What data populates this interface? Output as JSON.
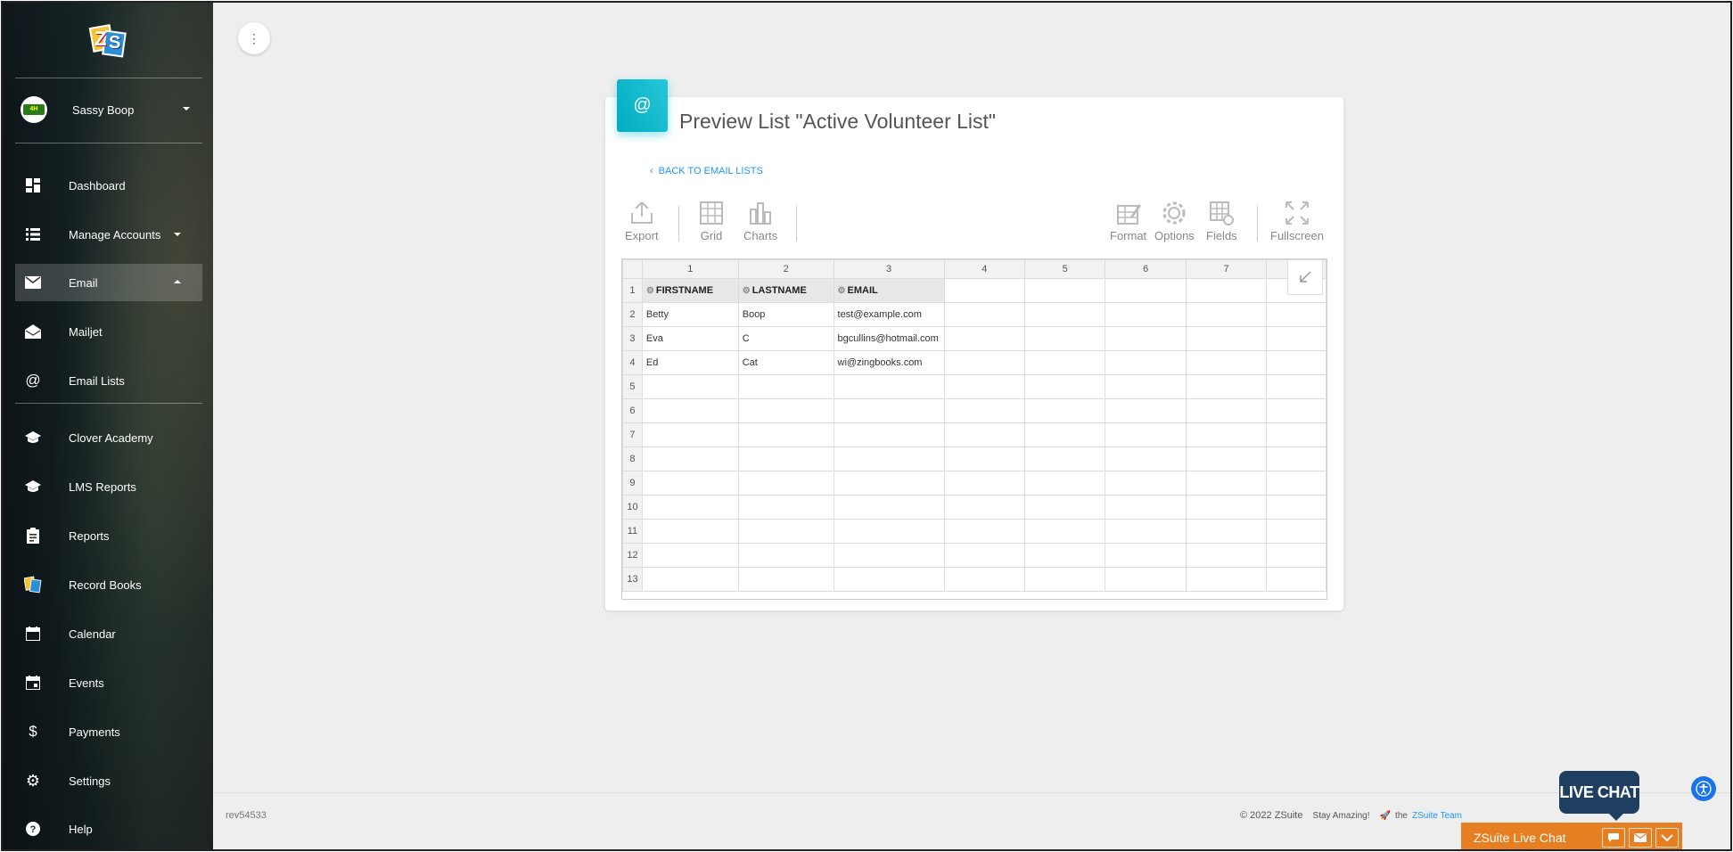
{
  "sidebar": {
    "user_name": "Sassy Boop",
    "avatar_text": "4H",
    "nav": [
      {
        "label": "Dashboard",
        "icon": "dashboard-icon"
      },
      {
        "label": "Manage Accounts",
        "icon": "list-icon"
      },
      {
        "label": "Email",
        "icon": "mail-icon"
      },
      {
        "label": "Mailjet",
        "icon": "drafts-icon"
      },
      {
        "label": "Email Lists",
        "icon": "at-icon"
      },
      {
        "label": "Clover Academy",
        "icon": "school-icon"
      },
      {
        "label": "LMS Reports",
        "icon": "school-icon"
      },
      {
        "label": "Reports",
        "icon": "assignment-icon"
      },
      {
        "label": "Record Books",
        "icon": "zsuite-logo-icon"
      },
      {
        "label": "Calendar",
        "icon": "calendar-icon"
      },
      {
        "label": "Events",
        "icon": "event-icon"
      },
      {
        "label": "Payments",
        "icon": "dollar-icon"
      },
      {
        "label": "Settings",
        "icon": "gear-icon"
      },
      {
        "label": "Help",
        "icon": "help-icon"
      }
    ]
  },
  "card": {
    "icon_glyph": "@",
    "title": "Preview List \"Active Volunteer List\"",
    "back_link": "BACK TO EMAIL LISTS",
    "back_chev": "‹"
  },
  "toolbar": {
    "export": "Export",
    "grid": "Grid",
    "charts": "Charts",
    "format": "Format",
    "options": "Options",
    "fields": "Fields",
    "fullscreen": "Fullscreen"
  },
  "grid": {
    "col_numbers": [
      "1",
      "2",
      "3",
      "4",
      "5",
      "6",
      "7",
      "8"
    ],
    "headers": [
      "FIRSTNAME",
      "LASTNAME",
      "EMAIL"
    ],
    "rows": [
      [
        "Betty",
        "Boop",
        "test@example.com"
      ],
      [
        "Eva",
        "C",
        "bgcullins@hotmail.com"
      ],
      [
        "Ed",
        "Cat",
        "wi@zingbooks.com"
      ]
    ],
    "row_numbers": [
      "1",
      "2",
      "3",
      "4",
      "5",
      "6",
      "7",
      "8",
      "9",
      "10",
      "11",
      "12",
      "13"
    ]
  },
  "footer": {
    "rev": "rev54533",
    "copyright": "© 2022 ZSuite",
    "stay": "Stay Amazing!",
    "the": "the",
    "team_link": "ZSuite Team"
  },
  "livechat": {
    "bubble": "LIVE CHAT",
    "bar_label": "ZSuite Live Chat"
  },
  "colors": {
    "accent": "#26c6da",
    "link": "#2196f3",
    "livechat_bar": "#e67e22",
    "livechat_bubble": "#1e3f60"
  }
}
